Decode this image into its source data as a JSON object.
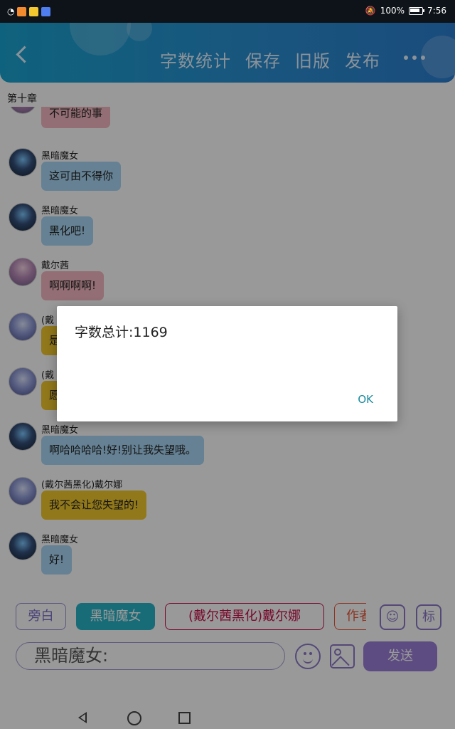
{
  "status_bar": {
    "battery": "100%",
    "time": "7:56"
  },
  "header": {
    "actions": [
      "字数统计",
      "保存",
      "旧版",
      "发布"
    ]
  },
  "chapter_title": "第十章",
  "messages": [
    {
      "sender": "",
      "text": "不可能的事",
      "color": "pink"
    },
    {
      "sender": "黑暗魔女",
      "text": "这可由不得你",
      "color": "blue"
    },
    {
      "sender": "黑暗魔女",
      "text": "黑化吧!",
      "color": "blue"
    },
    {
      "sender": "戴尔茜",
      "text": "啊啊啊啊!",
      "color": "pink"
    },
    {
      "sender": "(戴",
      "text": "是",
      "color": "yellow"
    },
    {
      "sender": "(戴",
      "text": "愿",
      "color": "yellow"
    },
    {
      "sender": "黑暗魔女",
      "text": "啊哈哈哈哈!好!别让我失望哦。",
      "color": "blue"
    },
    {
      "sender": "(戴尔茜黑化)戴尔娜",
      "text": "我不会让您失望的!",
      "color": "yellow"
    },
    {
      "sender": "黑暗魔女",
      "text": "好!",
      "color": "blue"
    }
  ],
  "characters": [
    "旁白",
    "黑暗魔女",
    "(戴尔茜黑化)戴尔娜",
    "作者"
  ],
  "tool_labels": {
    "mark": "标"
  },
  "input": {
    "value": "黑暗魔女:"
  },
  "send_label": "发送",
  "dialog": {
    "message": "字数总计:1169",
    "ok_label": "OK"
  }
}
